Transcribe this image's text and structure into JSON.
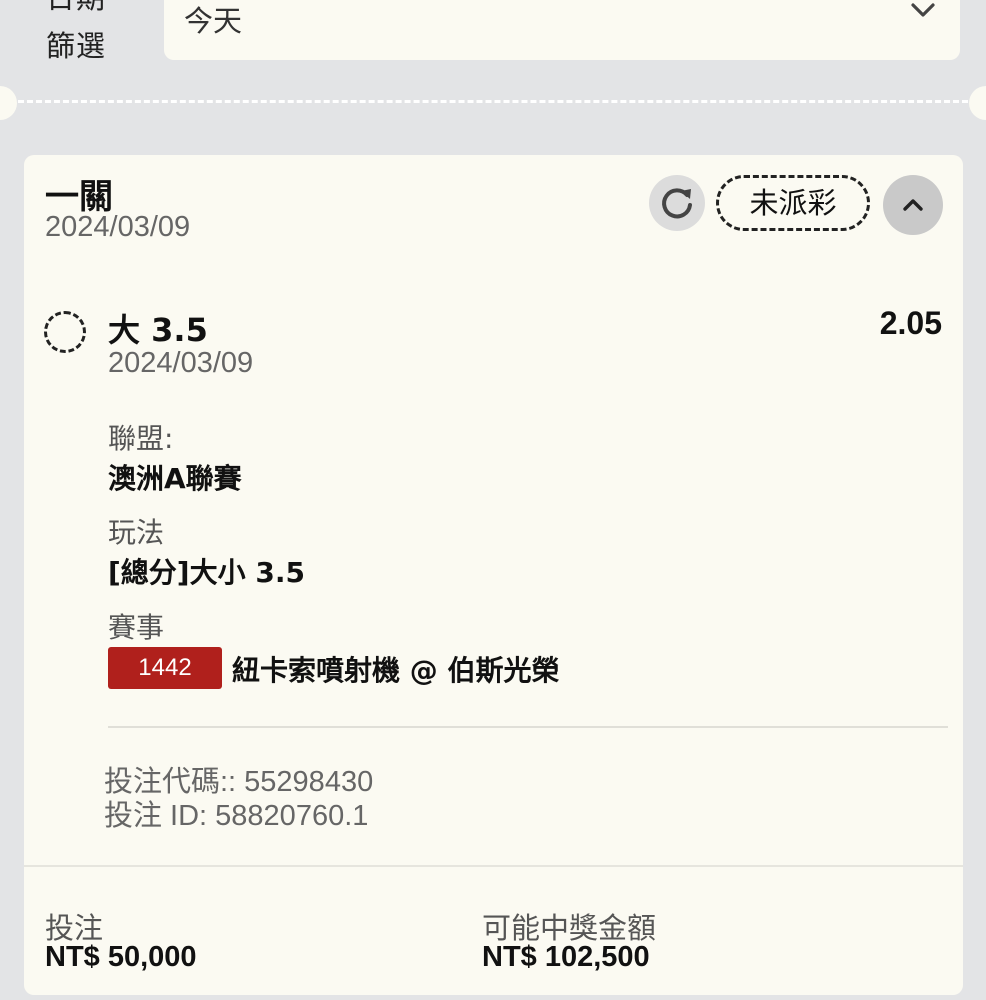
{
  "filter": {
    "label_line1": "日期",
    "label_line2": "篩選",
    "selected": "今天"
  },
  "card": {
    "title": "一關",
    "date": "2024/03/09",
    "status": "未派彩",
    "selection": {
      "name": "大 3.5",
      "odds": "2.05",
      "date": "2024/03/09",
      "league_label": "聯盟:",
      "league": "澳洲A聯賽",
      "market_label": "玩法",
      "market": "[總分]大小 3.5",
      "event_label": "賽事",
      "event_id": "1442",
      "event_name": "紐卡索噴射機 @ 伯斯光榮"
    },
    "bet_code": "投注代碼:: 55298430",
    "bet_id": "投注 ID: 58820760.1",
    "stake_label": "投注",
    "stake": "NT$ 50,000",
    "payout_label": "可能中獎金額",
    "payout": "NT$ 102,500"
  },
  "colors": {
    "background": "#e3e4e6",
    "card": "#fbfaf2",
    "event_badge": "#b0201c"
  },
  "icons": [
    "chevron-down-icon",
    "refresh-icon",
    "chevron-up-icon"
  ]
}
